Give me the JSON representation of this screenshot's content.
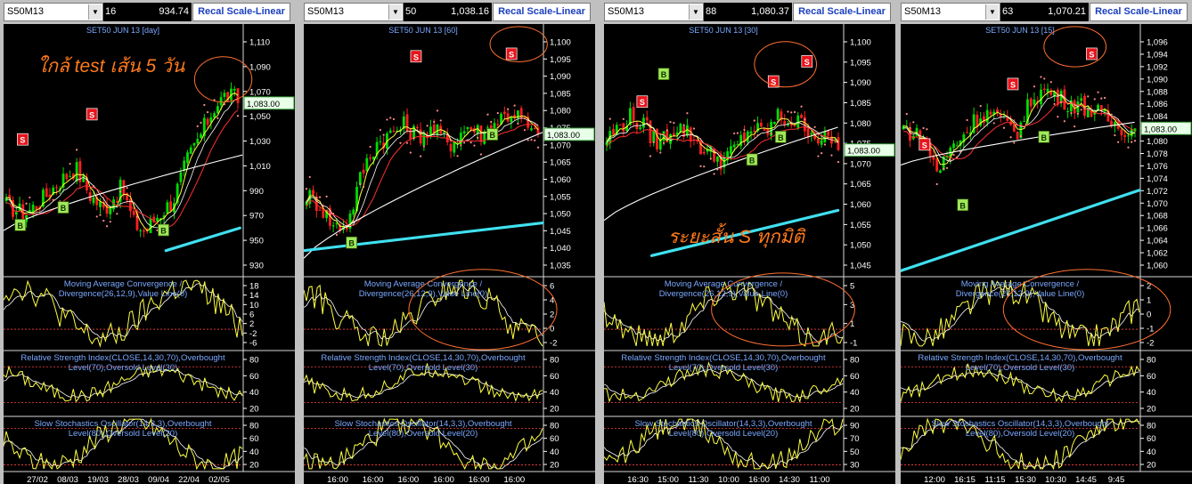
{
  "panels": [
    {
      "symbol": "S50M13",
      "count": "16",
      "price": "934.74",
      "recal": "Recal Scale-Linear",
      "title": "SET50 JUN 13",
      "period": "[day]",
      "price_ticks": [
        "1,110",
        "1,090",
        "1,070",
        "1,050",
        "1,030",
        "1,010",
        "990",
        "970",
        "950",
        "930"
      ],
      "last": "1,083.00",
      "macd_ticks": [
        "18",
        "14",
        "10",
        "6",
        "2",
        "-2",
        "-6"
      ],
      "rsi_ticks": [
        "80",
        "60",
        "40",
        "20"
      ],
      "stoch_ticks": [
        "80",
        "60",
        "40",
        "20"
      ],
      "dates": [
        "27/02",
        "08/03",
        "19/03",
        "28/03",
        "09/04",
        "22/04",
        "02/05"
      ],
      "annotation": "ใกล้ test เส้น 5 วัน",
      "signals": [
        {
          "t": "S"
        },
        {
          "t": "S"
        },
        {
          "t": "B"
        },
        {
          "t": "B"
        },
        {
          "t": "B"
        }
      ]
    },
    {
      "symbol": "S50M13",
      "count": "50",
      "price": "1,038.16",
      "recal": "Recal Scale-Linear",
      "title": "SET50 JUN 13",
      "period": "[60]",
      "price_ticks": [
        "1,100",
        "1,095",
        "1,090",
        "1,085",
        "1,080",
        "1,075",
        "1,070",
        "1,065",
        "1,060",
        "1,055",
        "1,050",
        "1,045",
        "1,040",
        "1,035"
      ],
      "last": "1,083.00",
      "macd_ticks": [
        "6",
        "4",
        "2",
        "0",
        "-2"
      ],
      "rsi_ticks": [
        "80",
        "60",
        "40",
        "20"
      ],
      "stoch_ticks": [
        "80",
        "60",
        "40",
        "20"
      ],
      "dates": [
        "16:00",
        "16:00",
        "16:00",
        "16:00",
        "16:00",
        "16:00"
      ],
      "annotation": "",
      "signals": [
        {
          "t": "S"
        },
        {
          "t": "S"
        },
        {
          "t": "B"
        },
        {
          "t": "B"
        }
      ]
    },
    {
      "symbol": "S50M13",
      "count": "88",
      "price": "1,080.37",
      "recal": "Recal Scale-Linear",
      "title": "SET50 JUN 13",
      "period": "[30]",
      "price_ticks": [
        "1,100",
        "1,095",
        "1,090",
        "1,085",
        "1,080",
        "1,075",
        "1,070",
        "1,065",
        "1,060",
        "1,055",
        "1,050",
        "1,045"
      ],
      "last": "1,083.00",
      "macd_ticks": [
        "5",
        "3",
        "1",
        "-1"
      ],
      "rsi_ticks": [
        "80",
        "60",
        "40",
        "20"
      ],
      "stoch_ticks": [
        "90",
        "70",
        "50",
        "30"
      ],
      "dates": [
        "16:30",
        "15:00",
        "11:30",
        "10:00",
        "16:00",
        "14:30",
        "11:00"
      ],
      "annotation": "ระยะสั้น S ทุกมิติ",
      "signals": [
        {
          "t": "S"
        },
        {
          "t": "S"
        },
        {
          "t": "S"
        },
        {
          "t": "B"
        },
        {
          "t": "B"
        },
        {
          "t": "B"
        }
      ]
    },
    {
      "symbol": "S50M13",
      "count": "63",
      "price": "1,070.21",
      "recal": "Recal Scale-Linear",
      "title": "SET50 JUN 13",
      "period": "[15]",
      "price_ticks": [
        "1,096",
        "1,094",
        "1,092",
        "1,090",
        "1,088",
        "1,086",
        "1,084",
        "1,082",
        "1,080",
        "1,078",
        "1,076",
        "1,074",
        "1,072",
        "1,070",
        "1,068",
        "1,066",
        "1,064",
        "1,062",
        "1,060"
      ],
      "last": "1,083.00",
      "macd_ticks": [
        "2",
        "1",
        "0",
        "-1",
        "-2"
      ],
      "rsi_ticks": [
        "80",
        "60",
        "40",
        "20"
      ],
      "stoch_ticks": [
        "80",
        "60",
        "40",
        "20"
      ],
      "dates": [
        "12:00",
        "16:15",
        "11:15",
        "15:30",
        "10:30",
        "14:45",
        "9:45"
      ],
      "annotation": "",
      "signals": [
        {
          "t": "S"
        },
        {
          "t": "S"
        },
        {
          "t": "S"
        },
        {
          "t": "B"
        },
        {
          "t": "B"
        }
      ]
    }
  ],
  "labels": {
    "macd1": "Moving Average Convergence /",
    "macd2": "Divergence(26,12,9),Value Line(0)",
    "rsi1": "Relative Strength Index(CLOSE,14,30,70),Overbought",
    "rsi2": "Level(70),Oversold Level(30)",
    "sto1": "Slow Stochastics Oscillator(14,3,3),Overbought",
    "sto2": "Level(80),Oversold Level(20)"
  },
  "colors": {
    "bull": "#00dd00",
    "bear": "#ff2020",
    "ma_fast": "#ffff40",
    "ma_mid": "#ff3030",
    "ma_slow": "#ffffff",
    "trend": "#40e0f0",
    "sar": "#ff8c8c",
    "circle": "#ff7030",
    "annotation": "#ff7a1a",
    "label": "#7aa8ff"
  }
}
